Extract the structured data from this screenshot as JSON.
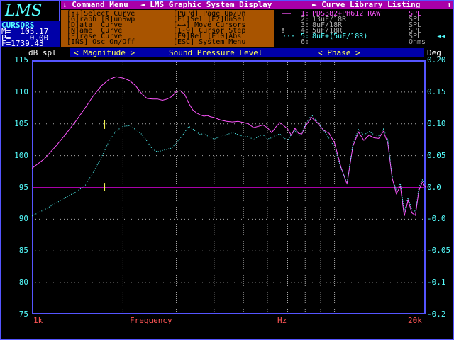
{
  "logo": "LMS",
  "menu_bar": {
    "items": [
      "↓ Command Menu",
      "◄ LMS Graphic System Display",
      "► Curve Library Listing",
      "↑"
    ]
  },
  "cursors": {
    "title": "CURSORS",
    "m": "M=  105.17",
    "p": "P=    0.00",
    "f": "F=1739.43"
  },
  "help": {
    "rows": [
      [
        "[↑↓]Select Curve",
        "[PuPd] Page Up/Dn"
      ],
      [
        "[G]raph [R]unSwp",
        "[F1]Sel [F2]UnSel"
      ],
      [
        "[D]ata  Curve",
        "[←→] Move Cursors"
      ],
      [
        "[N]ame  Curve",
        "[1-9] Cursor Step"
      ],
      [
        "[E]rase Curve",
        "[F9]Rel [F10]Abs"
      ],
      [
        "[INS] Osc On/Off",
        "[ESC] System Menu"
      ]
    ]
  },
  "library": {
    "entries": [
      {
        "marker": "——",
        "num": "1:",
        "name": "PDS382+PH612 RAW",
        "unit": "SPL",
        "color": "#ff55ff"
      },
      {
        "marker": "",
        "num": "2:",
        "name": "13uF/18R",
        "unit": "SPL",
        "color": "#aaaaaa"
      },
      {
        "marker": "",
        "num": "3:",
        "name": "8uF/18R",
        "unit": "SPL",
        "color": "#aaaaaa"
      },
      {
        "marker": "!",
        "num": "4:",
        "name": "5uF/18R",
        "unit": "SPL",
        "color": "#aaaaaa"
      },
      {
        "marker": "···",
        "num": "5:",
        "name": "8uF+(5uF/18R)",
        "unit": "SPL",
        "color": "#55ffff"
      },
      {
        "marker": "",
        "num": "6:",
        "name": "",
        "unit": "Ohms",
        "color": "#aaaaaa"
      }
    ],
    "scroll_icon": "◄◄"
  },
  "title_bar": {
    "left_unit": "dB spl",
    "magnitude": "< Magnitude >",
    "center": "Sound Pressure Level",
    "phase": "< Phase >",
    "right_unit": "Deg"
  },
  "bottom_axis": {
    "min": "1k",
    "label": "Frequency",
    "unit": "Hz",
    "max": "20k"
  },
  "chart_data": {
    "type": "line",
    "title": "Sound Pressure Level",
    "xlabel": "Frequency",
    "x_unit": "Hz",
    "x_scale": "log",
    "xlim": [
      1000,
      20000
    ],
    "ylabel": "dB spl",
    "ylim": [
      75,
      115
    ],
    "yticks": [
      115,
      110,
      105,
      100,
      95,
      90,
      85,
      80,
      75
    ],
    "y2label": "Deg",
    "y2ticks": [
      "0.20",
      "0.15",
      "0.10",
      "0.05",
      "0.0",
      "-0.0",
      "-0.05",
      "-0.1",
      "-0.2"
    ],
    "x_gridlines": [
      1000,
      2000,
      3000,
      4000,
      5000,
      6000,
      7000,
      8000,
      9000,
      10000,
      20000
    ],
    "cursor_level": 95,
    "series": [
      {
        "name": "PDS382+PH612 RAW",
        "color": "#ff55ff",
        "style": "solid",
        "x": [
          1000,
          1100,
          1200,
          1300,
          1400,
          1500,
          1600,
          1700,
          1800,
          1900,
          2000,
          2100,
          2200,
          2300,
          2400,
          2500,
          2600,
          2700,
          2800,
          2900,
          3000,
          3100,
          3200,
          3300,
          3400,
          3500,
          3600,
          3700,
          3800,
          3900,
          4000,
          4200,
          4400,
          4600,
          4800,
          5000,
          5200,
          5400,
          5600,
          5800,
          6000,
          6200,
          6400,
          6600,
          6800,
          7000,
          7200,
          7400,
          7600,
          7800,
          8000,
          8400,
          8800,
          9200,
          9600,
          10000,
          10500,
          11000,
          11500,
          12000,
          12500,
          13000,
          13500,
          14000,
          14500,
          15000,
          15500,
          16000,
          16500,
          17000,
          17500,
          18000,
          18500,
          19000,
          19500,
          20000
        ],
        "y": [
          98,
          99.5,
          101.5,
          103.5,
          105.5,
          107.5,
          109.5,
          111,
          112,
          112.4,
          112.2,
          111.8,
          111,
          109.8,
          109,
          108.9,
          108.9,
          108.7,
          108.9,
          109.3,
          110.1,
          110.2,
          109.6,
          108.2,
          107.2,
          106.7,
          106.4,
          106.2,
          106.3,
          106.1,
          106.0,
          105.6,
          105.4,
          105.3,
          105.4,
          105.2,
          105.0,
          104.4,
          104.6,
          104.8,
          104.4,
          103.6,
          104.5,
          105.2,
          104.7,
          104.2,
          103.2,
          104.3,
          103.5,
          103.4,
          104.6,
          106.0,
          105.1,
          104.0,
          103.5,
          102.0,
          98.2,
          95.5,
          101.5,
          103.7,
          102.4,
          103.2,
          102.8,
          102.7,
          103.8,
          102.0,
          96.5,
          94.0,
          95.2,
          90.5,
          93.0,
          91.0,
          90.6,
          94.5,
          95.8,
          95.0
        ]
      },
      {
        "name": "8uF+(5uF/18R)",
        "color": "#55ffff",
        "style": "dotted",
        "x": [
          1000,
          1100,
          1200,
          1300,
          1400,
          1500,
          1600,
          1700,
          1800,
          1900,
          2000,
          2100,
          2200,
          2300,
          2400,
          2500,
          2600,
          2700,
          2800,
          2900,
          3000,
          3100,
          3200,
          3300,
          3400,
          3500,
          3600,
          3700,
          3800,
          3900,
          4000,
          4200,
          4400,
          4600,
          4800,
          5000,
          5200,
          5400,
          5600,
          5800,
          6000,
          6200,
          6400,
          6600,
          6800,
          7000,
          7200,
          7400,
          7600,
          7800,
          8000,
          8400,
          8800,
          9200,
          9600,
          10000,
          10500,
          11000,
          11500,
          12000,
          12500,
          13000,
          13500,
          14000,
          14500,
          15000,
          15500,
          16000,
          16500,
          17000,
          17500,
          18000,
          18500,
          19000,
          19500,
          20000
        ],
        "y": [
          90.5,
          91.5,
          92.5,
          93.5,
          94.3,
          95.3,
          97.5,
          99.8,
          102.3,
          103.9,
          104.6,
          104.7,
          104.1,
          103.4,
          102.3,
          101.0,
          100.6,
          100.8,
          101.0,
          101.2,
          102.0,
          102.8,
          103.7,
          104.6,
          104.2,
          103.7,
          103.3,
          103.5,
          103.1,
          102.8,
          102.6,
          103.0,
          103.3,
          103.6,
          103.3,
          103.0,
          103.0,
          102.5,
          103.0,
          103.3,
          102.6,
          102.8,
          103.2,
          103.4,
          102.8,
          102.4,
          103.3,
          104.0,
          103.1,
          103.5,
          104.8,
          106.4,
          105.2,
          104.0,
          102.7,
          101.3,
          98.0,
          95.8,
          101.8,
          104.1,
          103.2,
          103.8,
          103.3,
          103.1,
          104.2,
          102.5,
          96.8,
          94.5,
          95.6,
          91.2,
          93.4,
          91.5,
          91.2,
          95.0,
          96.2,
          95.5
        ]
      }
    ]
  }
}
